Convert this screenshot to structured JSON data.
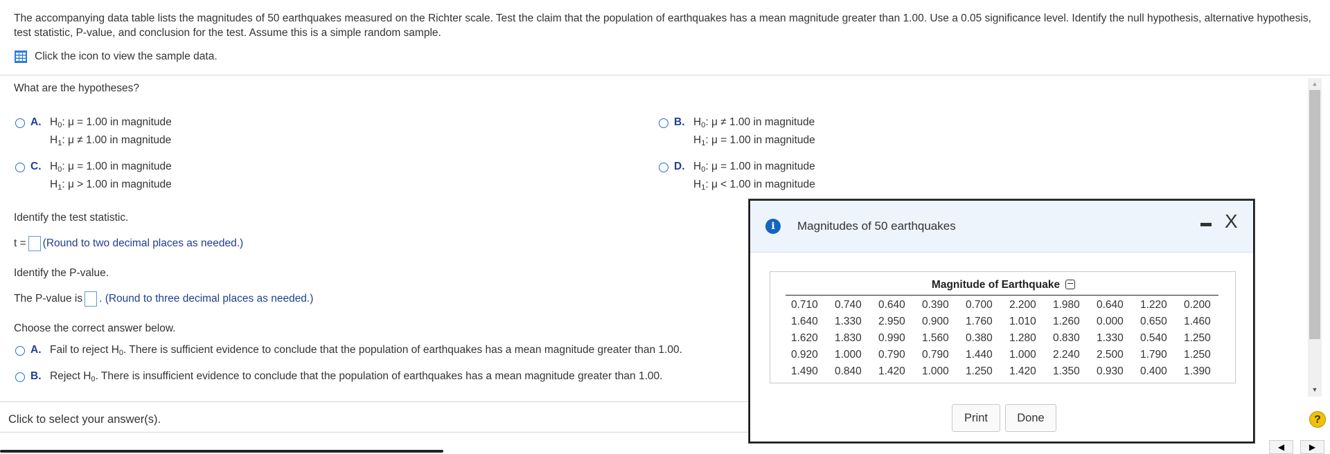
{
  "question": {
    "text": "The accompanying data table lists the magnitudes of 50 earthquakes measured on the Richter scale. Test the claim that the population of earthquakes has a mean magnitude greater than 1.00. Use a 0.05 significance level. Identify the null hypothesis, alternative hypothesis, test statistic, P-value, and conclusion for the test. Assume this is a simple random sample.",
    "data_link": "Click the icon to view the sample data."
  },
  "hypotheses": {
    "prompt": "What are the hypotheses?",
    "options": [
      {
        "letter": "A.",
        "h0_rest": ": μ = 1.00 in magnitude",
        "h1_rest": ": μ ≠ 1.00 in magnitude"
      },
      {
        "letter": "B.",
        "h0_rest": ": μ ≠ 1.00 in magnitude",
        "h1_rest": ": μ = 1.00 in magnitude"
      },
      {
        "letter": "C.",
        "h0_rest": ": μ = 1.00 in magnitude",
        "h1_rest": ": μ > 1.00 in magnitude"
      },
      {
        "letter": "D.",
        "h0_rest": ": μ = 1.00 in magnitude",
        "h1_rest": ": μ < 1.00 in magnitude"
      }
    ],
    "h0_base": "H",
    "h0_sub": "0",
    "h1_base": "H",
    "h1_sub": "1"
  },
  "test_statistic": {
    "prompt": "Identify the test statistic.",
    "label": "t =",
    "hint": "(Round to two decimal places as needed.)"
  },
  "p_value": {
    "prompt": "Identify the P-value.",
    "label": "The P-value is",
    "hint": ". (Round to three decimal places as needed.)"
  },
  "conclusion": {
    "prompt": "Choose the correct answer below.",
    "options": [
      {
        "letter": "A.",
        "pre": "Fail to reject H",
        "sub": "0",
        "post": ". There is sufficient evidence to conclude that the population of earthquakes has a mean magnitude greater than 1.00."
      },
      {
        "letter": "B.",
        "pre": "Reject H",
        "sub": "0",
        "post": ". There is insufficient evidence to conclude that the population of earthquakes has a mean magnitude greater than 1.00."
      }
    ]
  },
  "footer": {
    "status": "Click to select your answer(s).",
    "help": "?"
  },
  "popup": {
    "title": "Magnitudes of 50 earthquakes",
    "table_title": "Magnitude of Earthquake",
    "rows": [
      [
        "0.710",
        "0.740",
        "0.640",
        "0.390",
        "0.700",
        "2.200",
        "1.980",
        "0.640",
        "1.220",
        "0.200"
      ],
      [
        "1.640",
        "1.330",
        "2.950",
        "0.900",
        "1.760",
        "1.010",
        "1.260",
        "0.000",
        "0.650",
        "1.460"
      ],
      [
        "1.620",
        "1.830",
        "0.990",
        "1.560",
        "0.380",
        "1.280",
        "0.830",
        "1.330",
        "0.540",
        "1.250"
      ],
      [
        "0.920",
        "1.000",
        "0.790",
        "0.790",
        "1.440",
        "1.000",
        "2.240",
        "2.500",
        "1.790",
        "1.250"
      ],
      [
        "1.490",
        "0.840",
        "1.420",
        "1.000",
        "1.250",
        "1.420",
        "1.350",
        "0.930",
        "0.400",
        "1.390"
      ]
    ],
    "print_label": "Print",
    "done_label": "Done",
    "close_label": "X"
  },
  "colors": {
    "accent": "#1f6fd1",
    "option_letter": "#1f3f8f",
    "info": "#1565c0",
    "help": "#f2c200"
  }
}
